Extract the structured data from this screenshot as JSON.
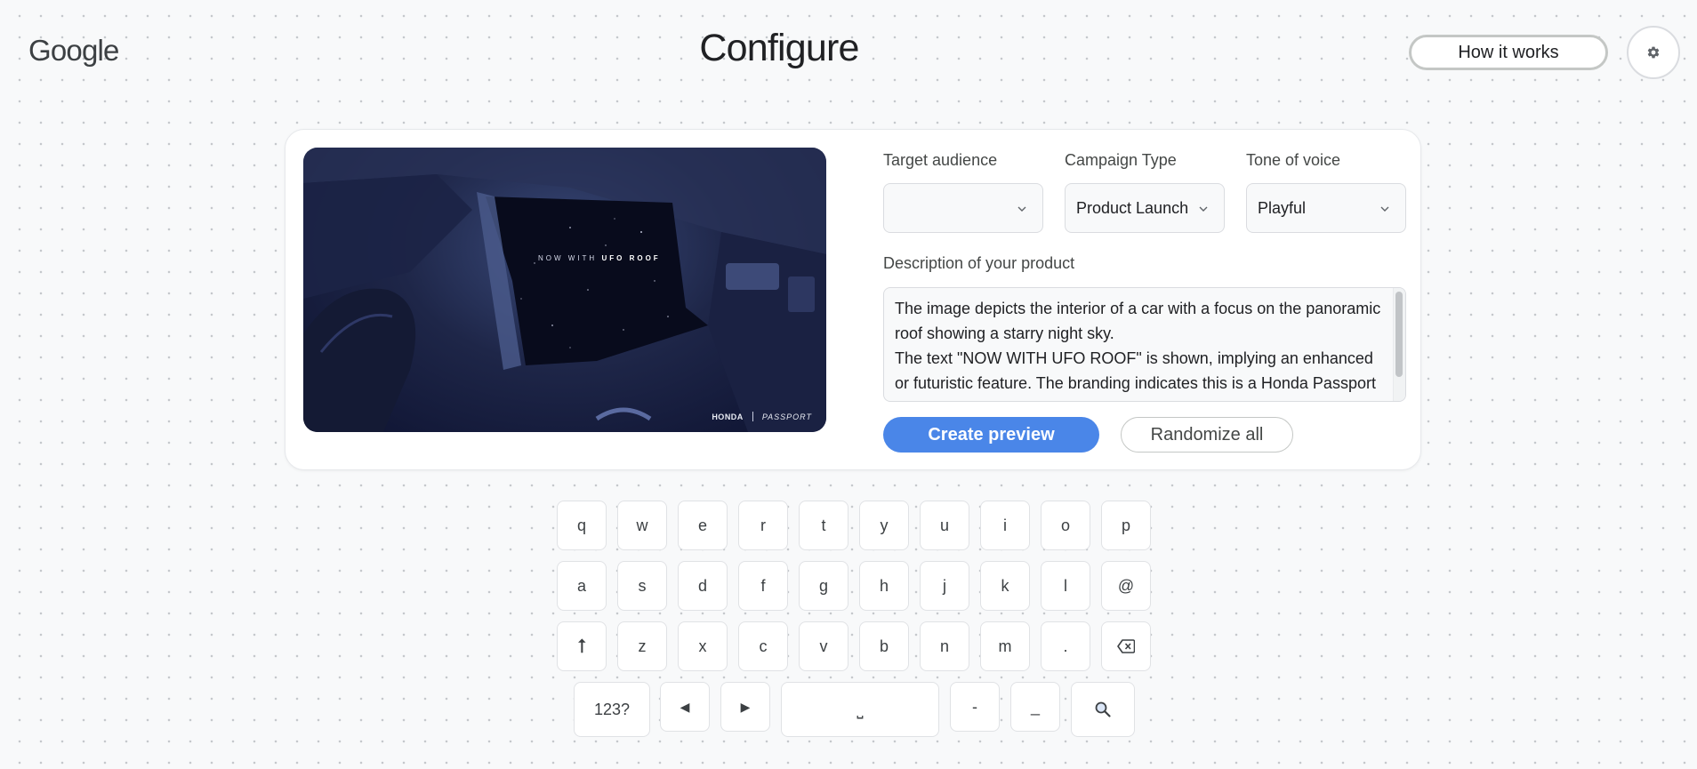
{
  "header": {
    "logo": "Google",
    "title": "Configure",
    "how_it_works": "How it works",
    "settings_icon": "gear-icon"
  },
  "product_image": {
    "overlay_prefix": "NOW WITH",
    "overlay_highlight": "UFO ROOF",
    "brand": "HONDA",
    "model": "PASSPORT"
  },
  "form": {
    "target_audience": {
      "label": "Target audience",
      "value": ""
    },
    "campaign_type": {
      "label": "Campaign Type",
      "value": "Product Launch"
    },
    "tone_of_voice": {
      "label": "Tone of voice",
      "value": "Playful"
    },
    "description": {
      "label": "Description of your product",
      "value": "The image depicts the interior of a car with a focus on the panoramic roof showing a starry night sky.\nThe text \"NOW WITH UFO ROOF\" is shown, implying an enhanced or futuristic feature. The branding indicates this is a Honda Passport vehicle."
    },
    "create_preview": "Create preview",
    "randomize_all": "Randomize all"
  },
  "keyboard": {
    "row1": [
      "q",
      "w",
      "e",
      "r",
      "t",
      "y",
      "u",
      "i",
      "o",
      "p"
    ],
    "row2": [
      "a",
      "s",
      "d",
      "f",
      "g",
      "h",
      "j",
      "k",
      "l",
      "@"
    ],
    "row3": [
      "⭡",
      "z",
      "x",
      "c",
      "v",
      "b",
      "n",
      "m",
      ".",
      "⌫"
    ],
    "row4": [
      "123?",
      "◀",
      "▶",
      "⎵",
      "-",
      "_",
      "🔍"
    ]
  },
  "colors": {
    "accent": "#4a86e8",
    "background": "#f8f9fa"
  }
}
